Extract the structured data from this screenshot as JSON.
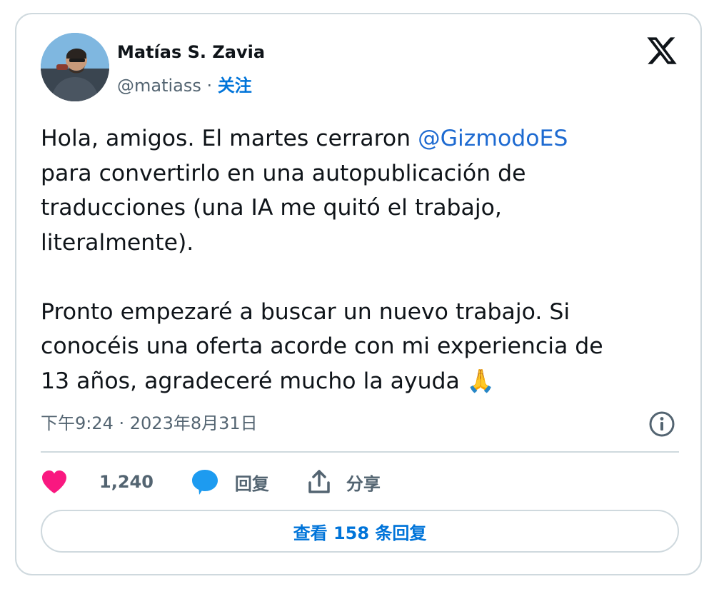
{
  "author": {
    "name": "Matías S. Zavia",
    "handle": "@matiass",
    "separator": "·",
    "follow_label": "关注"
  },
  "tweet": {
    "text_before_mention": "Hola, amigos. El martes cerraron ",
    "mention": "@GizmodoES",
    "text_after_mention": "\npara convertirlo en una autopublicación de\ntraducciones (una IA me quitó el trabajo,\nliteralmente).\n\nPronto empezaré a buscar un nuevo trabajo. Si\nconocéis una oferta acorde con mi experiencia de\n13 años, agradeceré mucho la ayuda ",
    "emoji": "🙏"
  },
  "timestamp": "下午9:24 · 2023年8月31日",
  "actions": {
    "likes_count": "1,240",
    "reply_label": "回复",
    "share_label": "分享"
  },
  "replies_button_label": "查看 158 条回复",
  "icons": {
    "logo": "x-logo-icon",
    "info": "info-icon",
    "like": "heart-icon",
    "reply": "reply-bubble-icon",
    "share": "share-upload-icon"
  },
  "colors": {
    "accent": "#0074d9",
    "like": "#f91880",
    "reply": "#1d9bf0",
    "border": "#cfd9de",
    "secondary_text": "#536471"
  }
}
